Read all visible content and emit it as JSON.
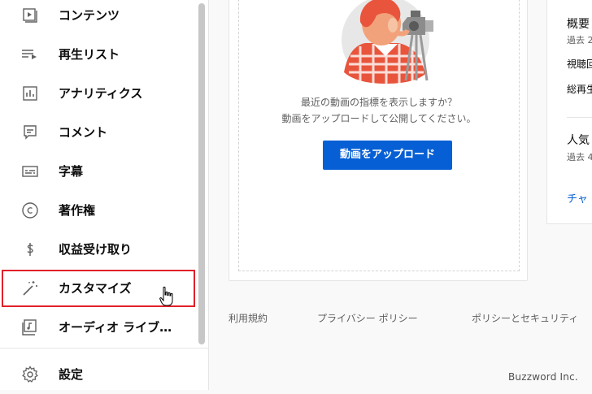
{
  "sidebar": {
    "items": [
      {
        "label": "コンテンツ",
        "icon": "content-icon"
      },
      {
        "label": "再生リスト",
        "icon": "playlist-icon"
      },
      {
        "label": "アナリティクス",
        "icon": "analytics-icon"
      },
      {
        "label": "コメント",
        "icon": "comment-icon"
      },
      {
        "label": "字幕",
        "icon": "subtitles-icon"
      },
      {
        "label": "著作権",
        "icon": "copyright-icon"
      },
      {
        "label": "収益受け取り",
        "icon": "dollar-icon"
      },
      {
        "label": "カスタマイズ",
        "icon": "magic-wand-icon"
      },
      {
        "label": "オーディオ ライブ…",
        "icon": "audio-library-icon"
      }
    ],
    "settings": {
      "label": "設定",
      "icon": "gear-icon"
    }
  },
  "main": {
    "message_line1": "最近の動画の指標を表示しますか？",
    "message_line2": "動画をアップロードして公開してください。",
    "upload_button": "動画をアップロード"
  },
  "right_card": {
    "title": "概要",
    "period": "過去 2",
    "views": "視聴回",
    "watch_time": "総再生",
    "popular_title": "人気",
    "popular_period": "過去 4",
    "link": "チャ"
  },
  "footer": {
    "terms": "利用規約",
    "privacy": "プライバシー ポリシー",
    "policy_safety": "ポリシーとセキュリティ"
  },
  "watermark": "Buzzword Inc.",
  "colors": {
    "accent": "#065fd4",
    "highlight": "#e0202a"
  }
}
